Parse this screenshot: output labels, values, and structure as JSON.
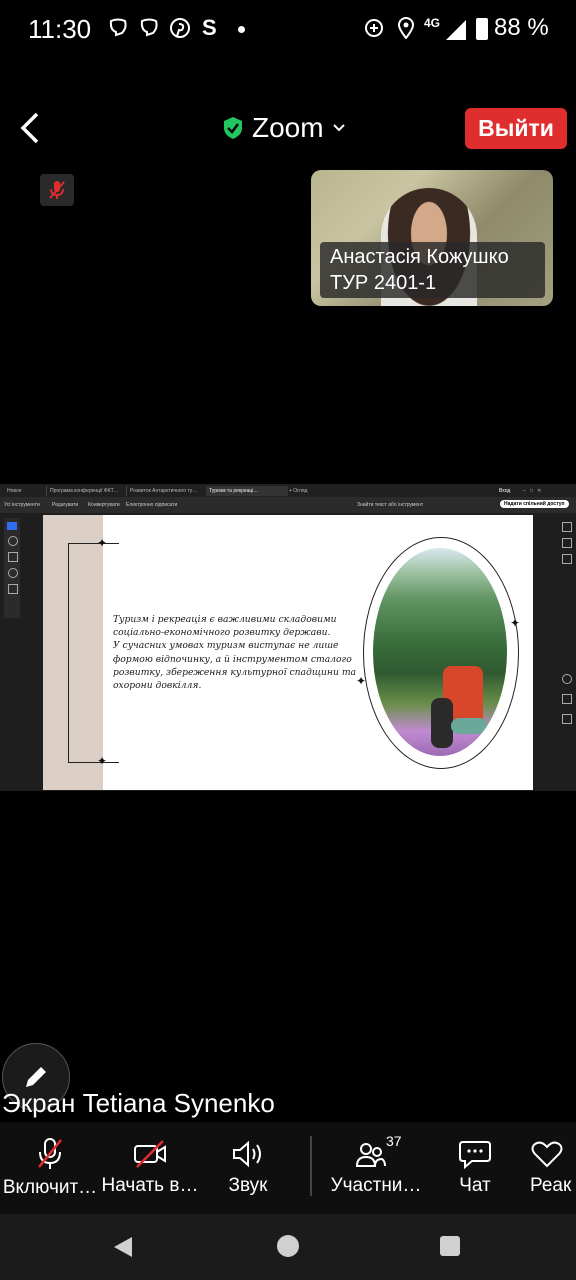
{
  "status_bar": {
    "time": "11:30",
    "left_icons": [
      "viber-icon",
      "viber-icon",
      "pinterest-icon",
      "s-icon",
      "dot-icon"
    ],
    "network": "4G",
    "battery": "88 %"
  },
  "meeting": {
    "app_title": "Zoom",
    "leave_label": "Выйти",
    "shield_color": "#22c55e",
    "leave_color": "#e02e2e"
  },
  "participant": {
    "name_line1": "Анастасія Кожушко",
    "name_line2": "ТУР 2401-1"
  },
  "shared_screen": {
    "owner_label": "Экран Tetiana Synenko",
    "browser_tabs": [
      "Новое",
      "Програма конференції ФКТ…",
      "Розвиток Антарктичного ту…",
      "Туризм та рекреаці…",
      "+ Огляд"
    ],
    "pdf_toolbar": {
      "tools": [
        "Усі інструменти",
        "Редагувати",
        "Конвертувати",
        "Електронно підписати"
      ],
      "search_placeholder": "Знайти текст або інструмент",
      "share_button": "Надати спільний доступ"
    },
    "slide": {
      "text_lines": [
        "Туризм і рекреація є важливими складовими",
        "соціально-економічного розвитку держави.",
        "У сучасних умовах туризм виступає не лише",
        "формою відпочинку, а й інструментом сталого",
        "розвитку, збереження культурної спадщини та",
        "охорони довкілля."
      ]
    }
  },
  "toolbar": {
    "items": [
      {
        "label": "Включит…",
        "icon": "mic-muted-icon"
      },
      {
        "label": "Начать в…",
        "icon": "video-off-icon"
      },
      {
        "label": "Звук",
        "icon": "speaker-icon"
      },
      {
        "label": "Участни…",
        "icon": "participants-icon",
        "count": "37"
      },
      {
        "label": "Чат",
        "icon": "chat-icon"
      },
      {
        "label": "Реак",
        "icon": "reaction-icon"
      }
    ]
  }
}
